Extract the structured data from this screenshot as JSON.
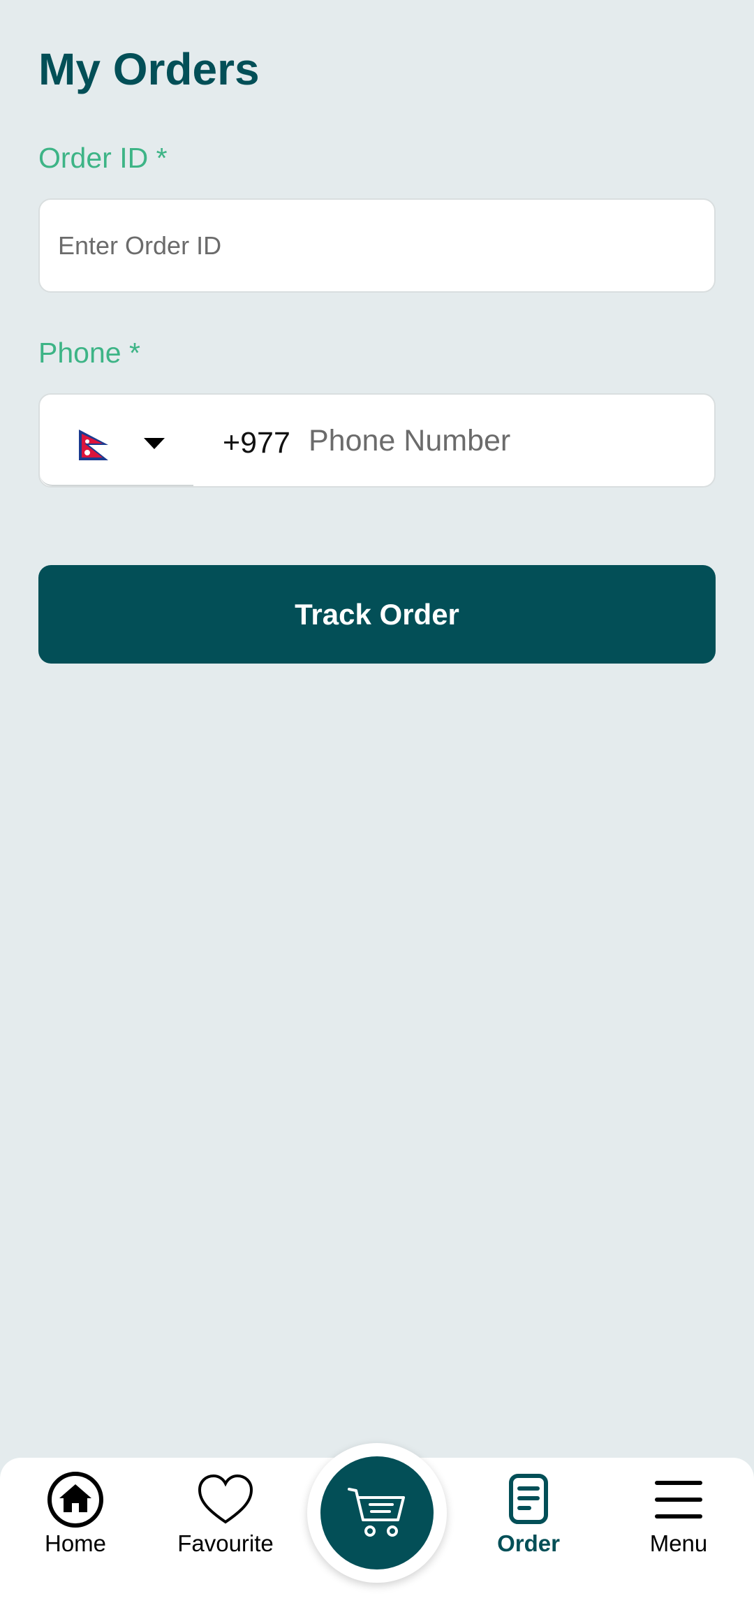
{
  "page": {
    "title": "My Orders"
  },
  "order_id": {
    "label": "Order ID *",
    "placeholder": "Enter Order ID",
    "value": ""
  },
  "phone": {
    "label": "Phone *",
    "country_flag": "nepal-flag-icon",
    "dial_code": "+977",
    "placeholder": "Phone Number",
    "value": ""
  },
  "track_button": {
    "label": "Track Order"
  },
  "nav": {
    "home": {
      "label": "Home",
      "icon": "home-icon"
    },
    "favourite": {
      "label": "Favourite",
      "icon": "heart-icon"
    },
    "cart": {
      "icon": "cart-icon"
    },
    "order": {
      "label": "Order",
      "icon": "order-document-icon",
      "active": true
    },
    "menu": {
      "label": "Menu",
      "icon": "hamburger-menu-icon"
    }
  },
  "colors": {
    "primary": "#034f57",
    "label_green": "#3db486",
    "background": "#e4ebed"
  }
}
